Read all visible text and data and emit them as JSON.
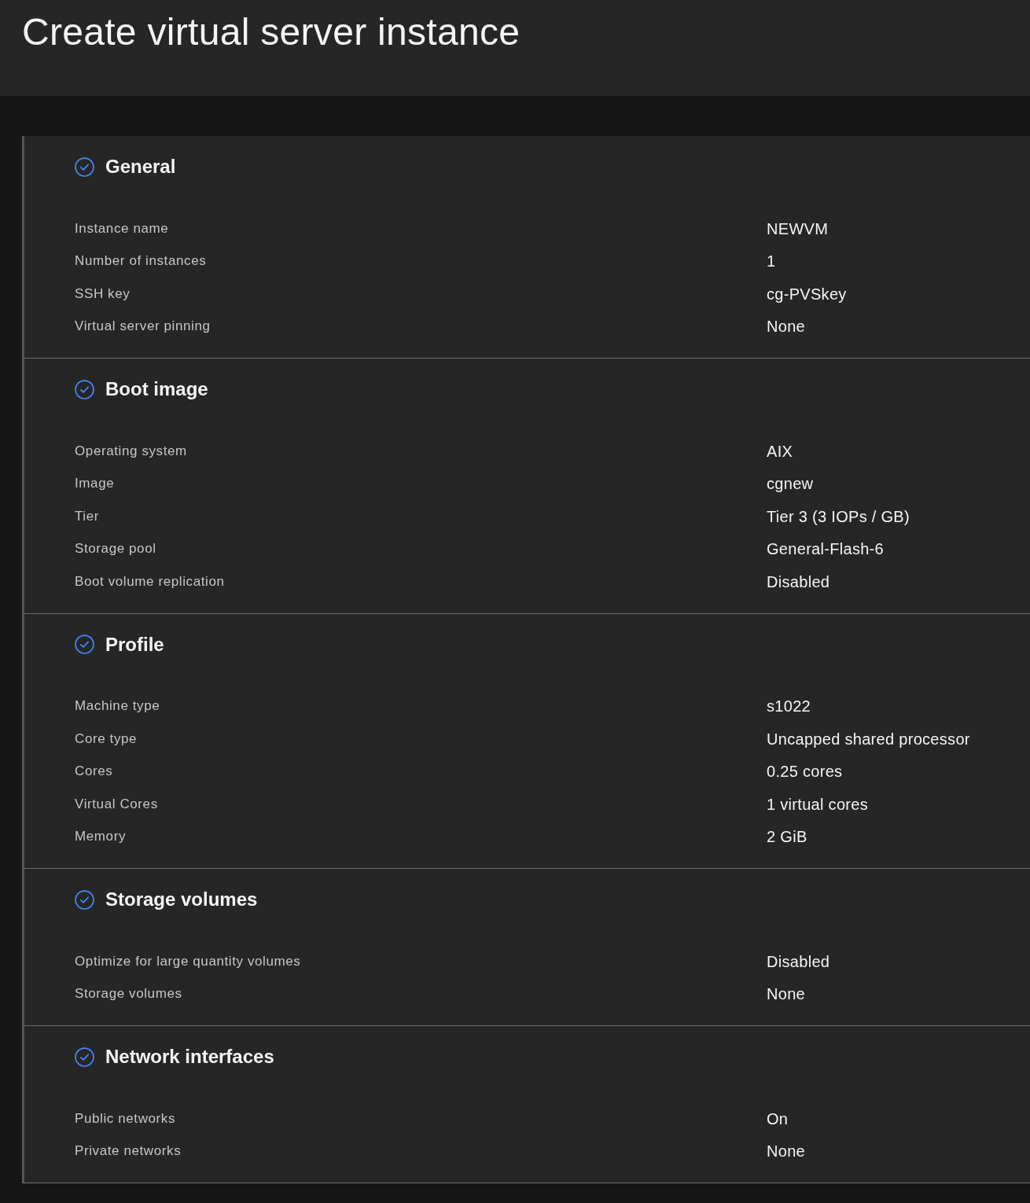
{
  "page": {
    "title": "Create virtual server instance"
  },
  "sections": [
    {
      "title": "General",
      "rows": [
        {
          "label": "Instance name",
          "value": "NEWVM"
        },
        {
          "label": "Number of instances",
          "value": "1"
        },
        {
          "label": "SSH key",
          "value": "cg-PVSkey"
        },
        {
          "label": "Virtual server pinning",
          "value": "None"
        }
      ]
    },
    {
      "title": "Boot image",
      "rows": [
        {
          "label": "Operating system",
          "value": "AIX"
        },
        {
          "label": "Image",
          "value": "cgnew"
        },
        {
          "label": "Tier",
          "value": "Tier 3 (3 IOPs / GB)"
        },
        {
          "label": "Storage pool",
          "value": "General-Flash-6"
        },
        {
          "label": "Boot volume replication",
          "value": "Disabled"
        }
      ]
    },
    {
      "title": "Profile",
      "rows": [
        {
          "label": "Machine type",
          "value": "s1022"
        },
        {
          "label": "Core type",
          "value": "Uncapped shared processor"
        },
        {
          "label": "Cores",
          "value": "0.25 cores"
        },
        {
          "label": "Virtual Cores",
          "value": "1 virtual cores"
        },
        {
          "label": "Memory",
          "value": "2 GiB"
        }
      ]
    },
    {
      "title": "Storage volumes",
      "rows": [
        {
          "label": "Optimize for large quantity volumes",
          "value": "Disabled"
        },
        {
          "label": "Storage volumes",
          "value": "None"
        }
      ]
    },
    {
      "title": "Network interfaces",
      "rows": [
        {
          "label": "Public networks",
          "value": "On"
        },
        {
          "label": "Private networks",
          "value": "None"
        }
      ]
    }
  ]
}
